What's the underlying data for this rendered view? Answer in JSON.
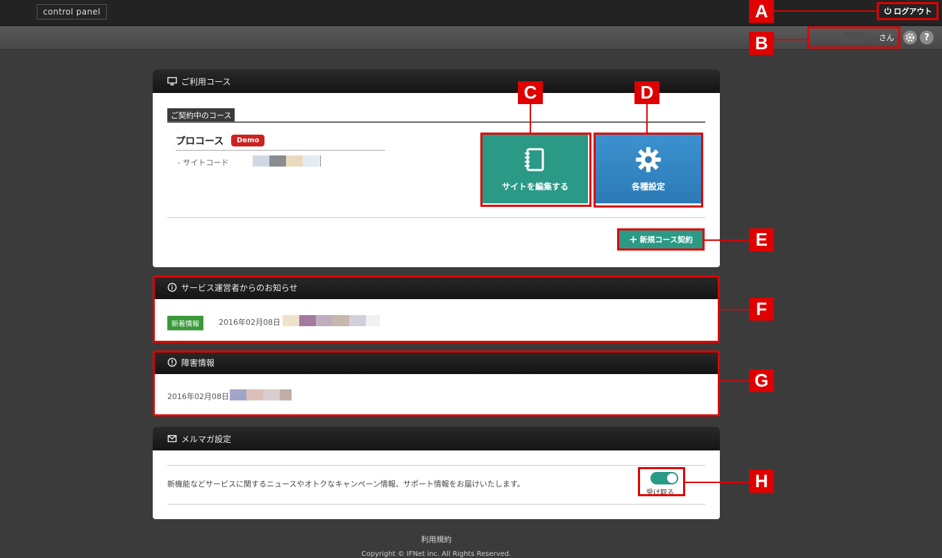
{
  "header": {
    "brand": "control panel",
    "logout_label": "ログアウト",
    "user_suffix": "さん",
    "settings_icon": "gear-icon",
    "help_label": "?"
  },
  "markers": [
    "A",
    "B",
    "C",
    "D",
    "E",
    "F",
    "G",
    "H"
  ],
  "course_panel": {
    "title": "ご利用コース",
    "section_tag": "ご契約中のコース",
    "course_name": "プロコース",
    "badge": "Demo",
    "site_code_label": "- サイトコード",
    "edit_site_label": "サイトを編集する",
    "settings_label": "各種設定",
    "new_contract_label": "新規コース契約"
  },
  "notice_panel": {
    "title": "サービス運営者からのお知らせ",
    "badge": "新着情報",
    "date": "2016年02月08日"
  },
  "failure_panel": {
    "title": "障害情報",
    "date": "2016年02月08日"
  },
  "mail_panel": {
    "title": "メルマガ設定",
    "description": "新機能などサービスに関するニュースやオトクなキャンペーン情報、サポート情報をお届けいたします。",
    "toggle_label": "受け取る",
    "toggle_on": true
  },
  "footer": {
    "terms_link": "利用規約",
    "copyright": "Copyright © IFNet inc. All Rights Reserved."
  },
  "colors": {
    "accent_green": "#2a9a86",
    "accent_blue": "#3b92cf",
    "callout_red": "#e00000"
  }
}
